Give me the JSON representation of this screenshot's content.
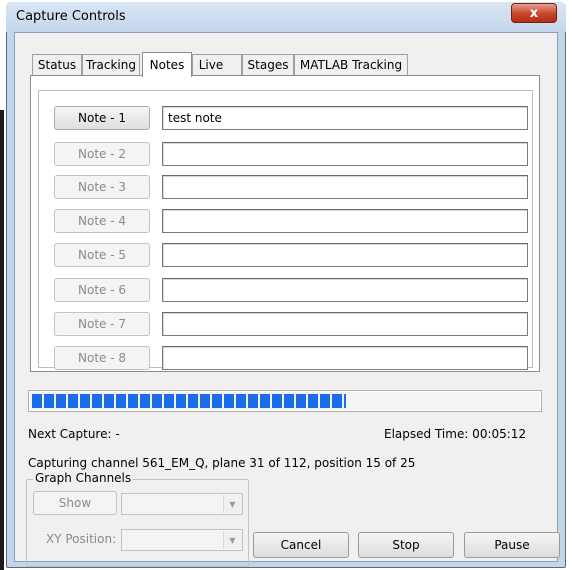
{
  "window": {
    "title": "Capture Controls",
    "close_glyph": "x"
  },
  "tabs": [
    {
      "label": "Status",
      "active": false
    },
    {
      "label": "Tracking",
      "active": false
    },
    {
      "label": "Notes",
      "active": true
    },
    {
      "label": "Live",
      "active": false
    },
    {
      "label": "Stages",
      "active": false
    },
    {
      "label": "MATLAB Tracking",
      "active": false
    }
  ],
  "notes": [
    {
      "button": "Note - 1",
      "value": "test note",
      "enabled": true
    },
    {
      "button": "Note - 2",
      "value": "",
      "enabled": false
    },
    {
      "button": "Note - 3",
      "value": "",
      "enabled": false
    },
    {
      "button": "Note - 4",
      "value": "",
      "enabled": false
    },
    {
      "button": "Note - 5",
      "value": "",
      "enabled": false
    },
    {
      "button": "Note - 6",
      "value": "",
      "enabled": false
    },
    {
      "button": "Note - 7",
      "value": "",
      "enabled": false
    },
    {
      "button": "Note - 8",
      "value": "",
      "enabled": false
    }
  ],
  "progress": {
    "fraction": 0.62,
    "color": "#1c6ee8"
  },
  "status": {
    "next_capture": "Next Capture: -",
    "elapsed": "Elapsed Time: 00:05:12",
    "capturing": "Capturing channel 561_EM_Q, plane 31 of 112, position 15 of 25"
  },
  "graph_channels": {
    "legend": "Graph Channels",
    "show_label": "Show",
    "xy_label": "XY Position:"
  },
  "actions": {
    "cancel": "Cancel",
    "stop": "Stop",
    "pause": "Pause"
  },
  "icons": {
    "combo_arrow": "dropdown-arrow-icon"
  }
}
